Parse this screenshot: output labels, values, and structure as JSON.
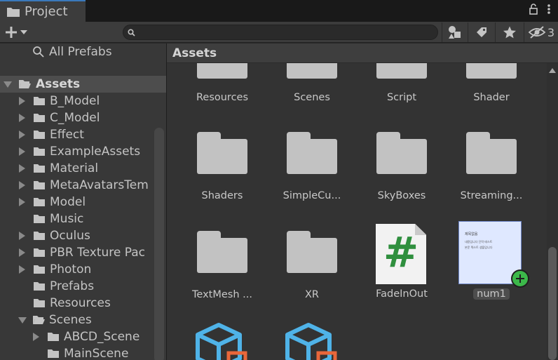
{
  "tab": {
    "title": "Project",
    "icon": "folder-icon"
  },
  "toolbar": {
    "add_icon": "plus-icon",
    "search": {
      "value": "",
      "placeholder": ""
    },
    "hidden_count": "3"
  },
  "left_panel": {
    "all_prefabs": "All Prefabs",
    "root": "Assets",
    "items": [
      {
        "label": "B_Model",
        "expandable": true
      },
      {
        "label": "C_Model",
        "expandable": true
      },
      {
        "label": "Effect",
        "expandable": true
      },
      {
        "label": "ExampleAssets",
        "expandable": true
      },
      {
        "label": "Material",
        "expandable": true
      },
      {
        "label": "MetaAvatarsTem",
        "expandable": true
      },
      {
        "label": "Model",
        "expandable": true
      },
      {
        "label": "Music",
        "expandable": false
      },
      {
        "label": "Oculus",
        "expandable": true
      },
      {
        "label": "PBR Texture Pac",
        "expandable": true
      },
      {
        "label": "Photon",
        "expandable": true
      },
      {
        "label": "Prefabs",
        "expandable": false
      },
      {
        "label": "Resources",
        "expandable": false
      },
      {
        "label": "Scenes",
        "expandable": true,
        "expanded": true
      }
    ],
    "scene_children": [
      "ABCD_Scene",
      "MainScene"
    ]
  },
  "right_panel": {
    "header": "Assets",
    "row0": [
      "Resources",
      "Scenes",
      "Script",
      "Shader"
    ],
    "row1": [
      "Shaders",
      "SimpleCu...",
      "SkyBoxes",
      "Streaming..."
    ],
    "row2": [
      "TextMesh ...",
      "XR",
      "FadeInOut",
      "num1"
    ],
    "script_glyph": "#",
    "num1_preview": [
      "제목없음",
      "내용입니다 단락 테스트",
      "본문 텍스트 샘플입니다"
    ]
  },
  "colors": {
    "accent": "#3a79bb",
    "folder": "#c2c2c2",
    "script_hash": "#2f8f3e",
    "prefab_blue": "#4fb3e8",
    "prefab_orange": "#e8673b",
    "add_green": "#3cb84a"
  }
}
